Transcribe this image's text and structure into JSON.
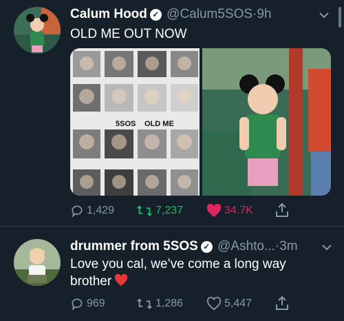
{
  "tweet1": {
    "display_name": "Calum Hood",
    "handle": "@Calum5SOS",
    "separator": "·",
    "time": "9h",
    "text": "OLD ME OUT NOW",
    "media_caption_left": "5SOS",
    "media_caption_right": "OLD ME",
    "replies": "1,429",
    "retweets": "7,237",
    "likes": "34.7K",
    "like_color": "#e0245e",
    "retweet_color": "#17bf63"
  },
  "tweet2": {
    "display_name": "drummer from 5SOS",
    "handle": "@Ashto...",
    "separator": "·",
    "time": "3m",
    "text_line1": "Love you cal, we’ve come a long way",
    "text_line2": "brother",
    "replies": "969",
    "retweets": "1,286",
    "likes": "5,447"
  },
  "colors": {
    "background": "#15202b",
    "secondary_text": "#8899a6",
    "divider": "#38444d"
  }
}
